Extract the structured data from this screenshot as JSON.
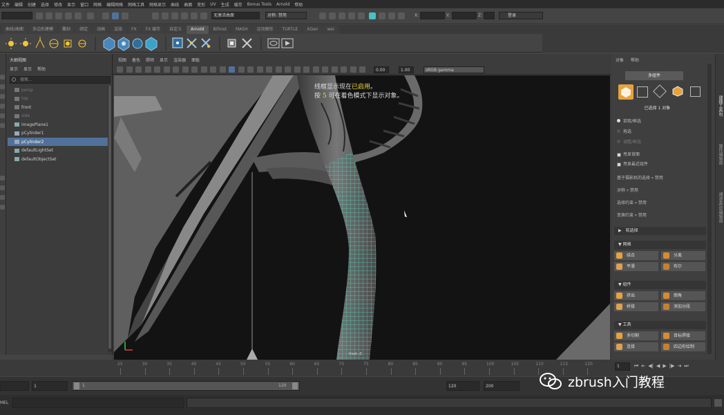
{
  "menubar": [
    "文件",
    "编辑",
    "创建",
    "选择",
    "修改",
    "显示",
    "窗口",
    "网格",
    "编辑网格",
    "网格工具",
    "网格显示",
    "曲线",
    "曲面",
    "变形",
    "UV",
    "生成",
    "缓存",
    "Bonus Tools",
    "Arnold",
    "帮助"
  ],
  "status": {
    "objects_dropdown": "无激活曲面",
    "symmetry_label": "对称: 禁用",
    "login": "登录",
    "xyz": [
      "X:",
      "Y:",
      "Z:"
    ]
  },
  "shelf_tabs": [
    {
      "label": "曲线/曲面",
      "active": false
    },
    {
      "label": "多边形建模",
      "active": false
    },
    {
      "label": "雕刻",
      "active": false
    },
    {
      "label": "绑定",
      "active": false
    },
    {
      "label": "动画",
      "active": false
    },
    {
      "label": "渲染",
      "active": false
    },
    {
      "label": "FX",
      "active": false
    },
    {
      "label": "FX 缓存",
      "active": false
    },
    {
      "label": "自定义",
      "active": false
    },
    {
      "label": "Arnold",
      "active": true
    },
    {
      "label": "Bifrost",
      "active": false
    },
    {
      "label": "MASH",
      "active": false
    },
    {
      "label": "运动图形",
      "active": false
    },
    {
      "label": "TURTLE",
      "active": false
    },
    {
      "label": "XGen",
      "active": false
    },
    {
      "label": "wei",
      "active": false
    }
  ],
  "outliner": {
    "title": "大纲视图",
    "menu": [
      "显示",
      "显示",
      "帮助"
    ],
    "search_placeholder": "搜索...",
    "items": [
      {
        "label": "persp",
        "dim": true,
        "selected": false,
        "icon": "camera-icon"
      },
      {
        "label": "top",
        "dim": true,
        "selected": false,
        "icon": "camera-icon"
      },
      {
        "label": "front",
        "dim": false,
        "selected": false,
        "icon": "camera-icon"
      },
      {
        "label": "side",
        "dim": true,
        "selected": false,
        "icon": "camera-icon"
      },
      {
        "label": "imagePlane1",
        "dim": false,
        "selected": false,
        "icon": "image-plane-icon"
      },
      {
        "label": "pCylinder1",
        "dim": false,
        "selected": false,
        "icon": "mesh-icon"
      },
      {
        "label": "pCylinder2",
        "dim": false,
        "selected": true,
        "icon": "mesh-icon"
      },
      {
        "label": "defaultLightSet",
        "dim": false,
        "selected": false,
        "icon": "set-icon"
      },
      {
        "label": "defaultObjectSet",
        "dim": false,
        "selected": false,
        "icon": "set-icon"
      }
    ]
  },
  "viewport": {
    "menu": [
      "视图",
      "着色",
      "照明",
      "显示",
      "渲染器",
      "面板"
    ],
    "exposure": "0.00",
    "gamma": "1.00",
    "color_space": "sRGB gamma",
    "message_line1_prefix": "线框显示现在",
    "message_line1_highlight": "已启用",
    "message_line1_suffix": "。",
    "message_line2_prefix": "按 ",
    "message_line2_key": "5",
    "message_line2_suffix": " 可在着色模式下显示对象。",
    "camera_label": "front -Z"
  },
  "attr": {
    "menu": [
      "对象",
      "帮助"
    ],
    "mode_button": "多组件",
    "selection_info": "已选择 1 对象",
    "radio_options": [
      "拾取/框选",
      "拖选",
      "调整/框选"
    ],
    "checks": [
      "亮显背面",
      "亮显最近组件"
    ],
    "rows": [
      {
        "label": "基于摄影机的选择",
        "value": "禁用"
      },
      {
        "label": "对称",
        "value": "禁用"
      },
      {
        "label": "选择约束",
        "value": "禁用"
      },
      {
        "label": "变换约束",
        "value": "禁用"
      }
    ],
    "soft_select": "软选择",
    "sections": [
      {
        "title": "网格",
        "buttons": [
          "结合",
          "分离",
          "平滑",
          "布尔"
        ]
      },
      {
        "title": "组件",
        "buttons": [
          "挤出",
          "倒角",
          "桥接",
          "添加分段"
        ]
      },
      {
        "title": "工具",
        "buttons": [
          "多切割",
          "目标焊接",
          "连接",
          "四边形绘制"
        ]
      }
    ],
    "side_tabs": [
      "建模工具包",
      "属性编辑器",
      "通道盒/层编辑器"
    ]
  },
  "timeline": {
    "ticks": [
      "25",
      "30",
      "35",
      "40",
      "45",
      "50",
      "55",
      "60",
      "65",
      "70",
      "75",
      "80",
      "85",
      "90",
      "95",
      "100",
      "105",
      "110",
      "115",
      "120"
    ],
    "current_frame": "1"
  },
  "range": {
    "start": "1",
    "playback_start": "1",
    "slider_left": "1",
    "slider_right": "120",
    "playback_end": "120",
    "end": "200"
  },
  "cmdline": {
    "lang": "MEL"
  },
  "watermark": "zbrush入门教程",
  "colors": {
    "wireframe": "#48e6c3",
    "selection": "#51719a",
    "highlight": "#f2d83a",
    "accent_orange": "#e8a23c"
  }
}
